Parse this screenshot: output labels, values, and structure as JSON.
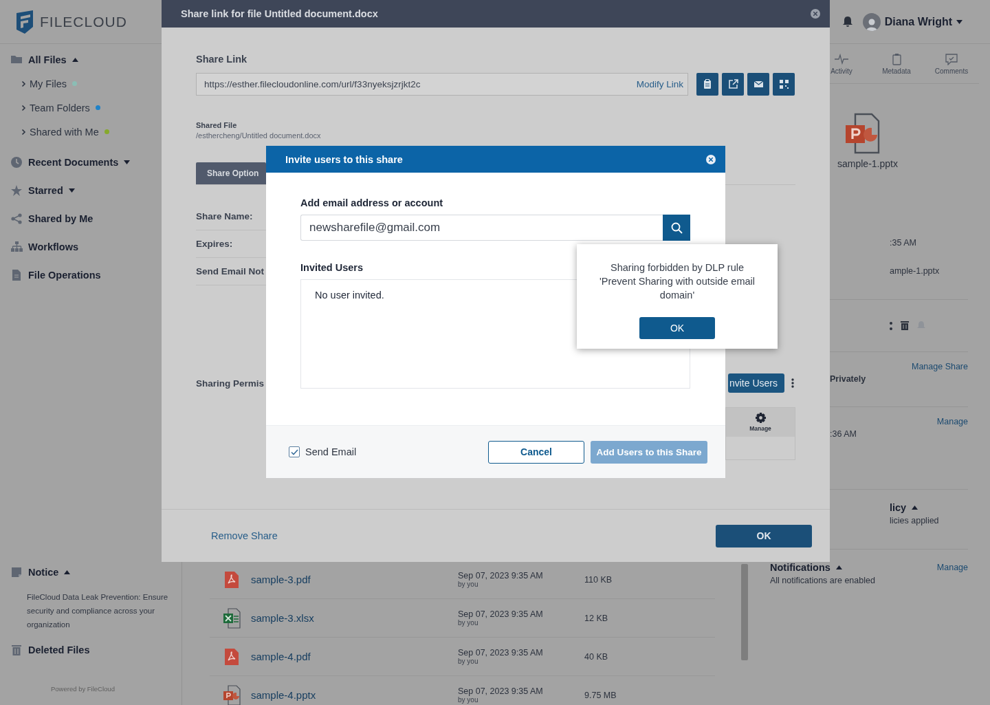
{
  "header": {
    "logo": "FILECLOUD",
    "user_name": "Diana Wright"
  },
  "sidebar": {
    "items": [
      {
        "label": "All Files",
        "expanded": true,
        "children": [
          {
            "label": "My Files",
            "expanded": false,
            "color": "#8bbdb5"
          },
          {
            "label": "Team Folders",
            "expanded": false,
            "color": "#1f82c8"
          },
          {
            "label": "Shared with Me",
            "expanded": false,
            "color": "#86a92c"
          }
        ]
      },
      {
        "label": "Recent Documents",
        "expanded": false
      },
      {
        "label": "Starred",
        "expanded": false
      },
      {
        "label": "Shared by Me"
      },
      {
        "label": "Workflows"
      },
      {
        "label": "File Operations"
      }
    ],
    "notice": {
      "title": "Notice",
      "expanded": true,
      "text": "FileCloud Data Leak Prevention: Ensure security and compliance across your organization"
    },
    "bottom_items": [
      {
        "label": "Deleted Files"
      }
    ],
    "footer": "Powered by FileCloud"
  },
  "files": {
    "rows": [
      {
        "kind": "pdf",
        "name": "sample-3.pdf",
        "date": "Sep 07, 2023 9:35 AM",
        "by": "by you",
        "size": "110 KB"
      },
      {
        "kind": "xlsx",
        "name": "sample-3.xlsx",
        "date": "Sep 07, 2023 9:35 AM",
        "by": "by you",
        "size": "12 KB"
      },
      {
        "kind": "pdf",
        "name": "sample-4.pdf",
        "date": "Sep 07, 2023 9:35 AM",
        "by": "by you",
        "size": "40 KB"
      },
      {
        "kind": "pptx",
        "name": "sample-4.pptx",
        "date": "Sep 07, 2023 9:35 AM",
        "by": "by you",
        "size": "9.75 MB"
      }
    ]
  },
  "details": {
    "tabs": [
      {
        "label": "Activity"
      },
      {
        "label": "Metadata"
      },
      {
        "label": "Comments"
      }
    ],
    "preview": {
      "kind": "pptx",
      "name": "sample-1.pptx"
    },
    "info": [
      ":35 AM",
      "ample-1.pptx"
    ],
    "share": {
      "link": "Manage Share",
      "text": "Privately"
    },
    "versions": {
      "link": "Manage",
      "text": ":36 AM"
    },
    "policy": {
      "title": "licy",
      "expanded": true,
      "text": "licies applied"
    },
    "notifications": {
      "title": "Notifications",
      "expanded": true,
      "link": "Manage",
      "text": "All notifications are enabled"
    }
  },
  "share_dialog": {
    "title": "Share link for file Untitled document.docx",
    "link_label": "Share Link",
    "url": "https://esther.filecloudonline.com/url/f33nyeksjzrjkt2c",
    "modify_link": "Modify Link",
    "shared_file_label": "Shared File",
    "shared_file_path": "/esthercheng/Untitled document.docx",
    "tabs": [
      {
        "label": "Share Option",
        "selected": true
      }
    ],
    "fields": [
      "Share Name:",
      "Expires:",
      "Send Email Not"
    ],
    "permissions_label": "Sharing Permis",
    "invite_button": "nvite Users",
    "permissions_table": {
      "columns": [
        "Manage"
      ]
    },
    "remove_link": "Remove Share",
    "ok_button": "OK"
  },
  "invite_dialog": {
    "title": "Invite users to this share",
    "email_label": "Add email address or account",
    "email_value": "newsharefile@gmail.com",
    "invited_label": "Invited Users",
    "invited_empty": "No user invited.",
    "send_email": {
      "label": "Send Email",
      "checked": true
    },
    "cancel_button": "Cancel",
    "add_button": {
      "label": "Add Users to this Share",
      "disabled": true
    }
  },
  "alert": {
    "message": "Sharing forbidden by DLP rule 'Prevent Sharing with outside email domain'",
    "ok_button": "OK"
  }
}
